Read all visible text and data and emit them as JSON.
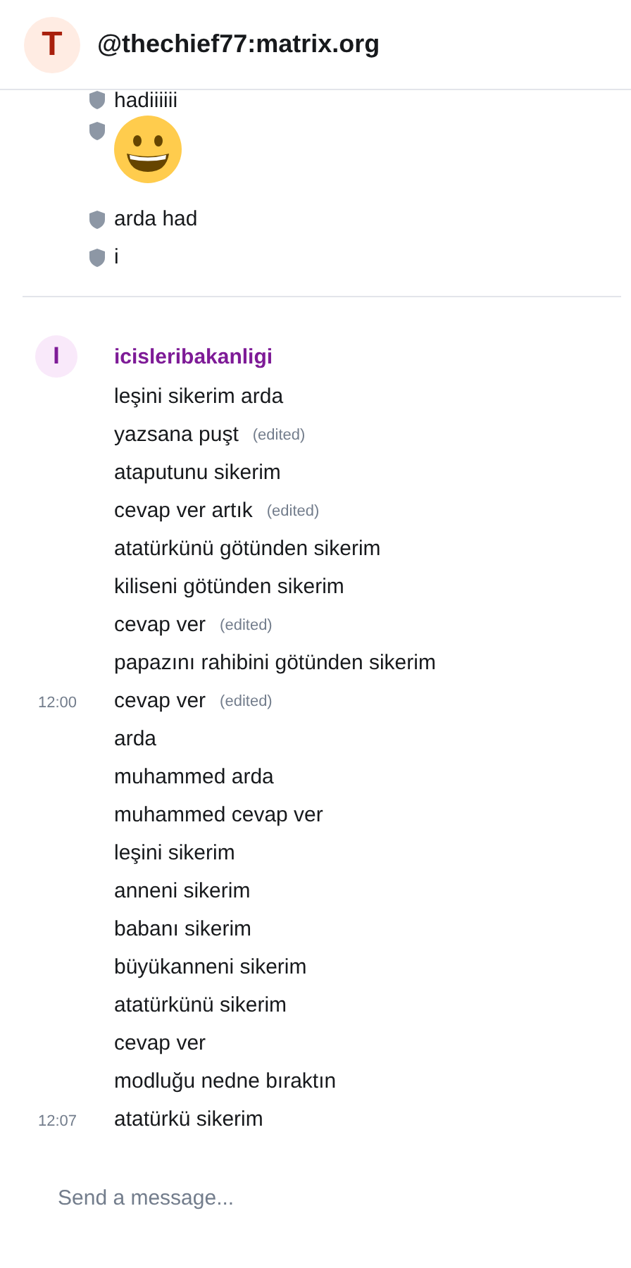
{
  "header": {
    "avatar": "T",
    "title": "@thechief77:matrix.org"
  },
  "earlier_messages": [
    {
      "kind": "text",
      "text": "hadiiiiii"
    },
    {
      "kind": "emoji"
    },
    {
      "kind": "text",
      "text": "arda had"
    },
    {
      "kind": "text",
      "text": "i"
    }
  ],
  "group": {
    "avatar": "I",
    "sender": "icisleribakanligi",
    "messages": [
      {
        "text": "leşini sikerim arda"
      },
      {
        "text": "yazsana puşt",
        "edited_label": "(edited)"
      },
      {
        "text": "ataputunu sikerim"
      },
      {
        "text": "cevap ver artık",
        "edited_label": "(edited)"
      },
      {
        "text": "atatürkünü götünden sikerim"
      },
      {
        "text": "kiliseni götünden sikerim"
      },
      {
        "text": "cevap ver",
        "edited_label": "(edited)"
      },
      {
        "text": "papazını rahibini götünden sikerim"
      },
      {
        "time": "12:00",
        "text": "cevap ver",
        "edited_label": "(edited)"
      },
      {
        "text": "arda"
      },
      {
        "text": "muhammed arda"
      },
      {
        "text": "muhammed cevap ver"
      },
      {
        "text": "leşini sikerim"
      },
      {
        "text": "anneni sikerim"
      },
      {
        "text": "babanı sikerim"
      },
      {
        "text": "büyükanneni sikerim"
      },
      {
        "text": "atatürkünü sikerim"
      },
      {
        "text": "cevap ver"
      },
      {
        "text": "modluğu nedne bıraktın"
      },
      {
        "time": "12:07",
        "text": "atatürkü sikerim"
      }
    ]
  },
  "composer": {
    "placeholder": "Send a message..."
  }
}
